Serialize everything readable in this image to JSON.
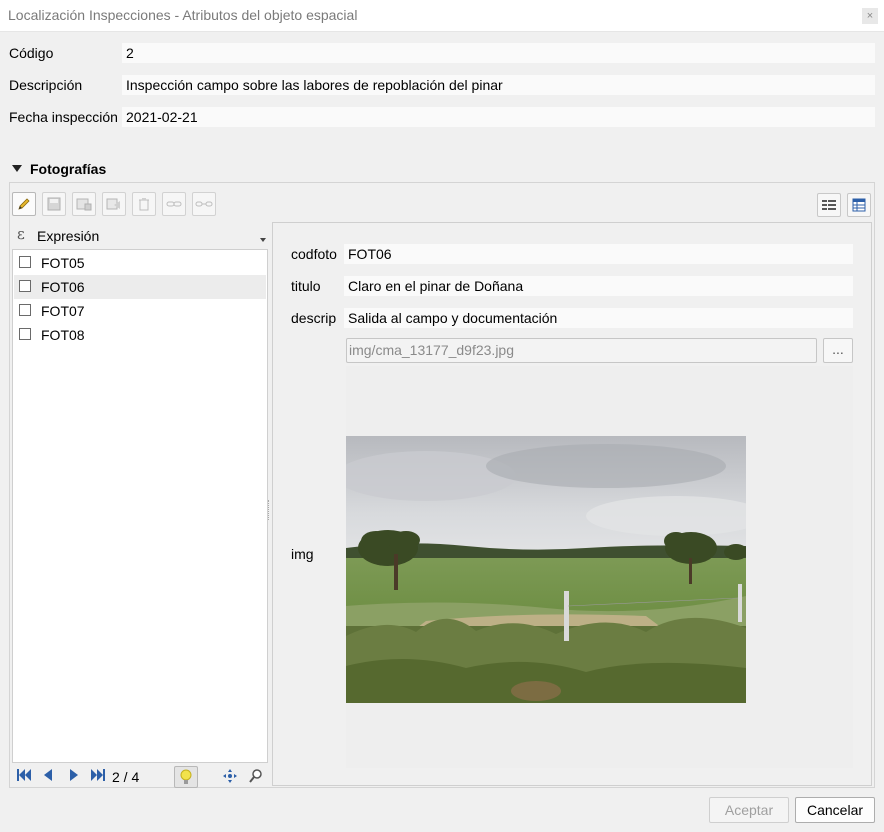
{
  "window": {
    "title": "Localización Inspecciones - Atributos del objeto espacial",
    "close_glyph": "×"
  },
  "form": {
    "fields": [
      {
        "label": "Código",
        "value": "2"
      },
      {
        "label": "Descripción",
        "value": "Inspección campo sobre las labores de repoblación del pinar"
      },
      {
        "label": "Fecha inspección",
        "value": "2021-02-21"
      }
    ]
  },
  "section": {
    "title": "Fotografías"
  },
  "toolbar": {
    "buttons": [
      "pencil-icon",
      "save-icon",
      "add-feature-icon",
      "duplicate-icon",
      "delete-icon",
      "link-icon",
      "unlink-icon"
    ],
    "views": [
      "form-view-icon",
      "table-view-icon"
    ]
  },
  "list": {
    "expression_label": "Expresión",
    "items": [
      {
        "label": "FOT05",
        "selected": false
      },
      {
        "label": "FOT06",
        "selected": true
      },
      {
        "label": "FOT07",
        "selected": false
      },
      {
        "label": "FOT08",
        "selected": false
      }
    ]
  },
  "navigation": {
    "count": "2 / 4"
  },
  "detail": {
    "fields": [
      {
        "label": "codfoto",
        "value": "FOT06"
      },
      {
        "label": "titulo",
        "value": "Claro en el pinar de Doñana"
      },
      {
        "label": "descrip",
        "value": "Salida al campo y documentación"
      }
    ],
    "img_label": "img",
    "img_path": "img/cma_13177_d9f23.jpg",
    "browse_label": "..."
  },
  "footer": {
    "accept_label": "Aceptar",
    "cancel_label": "Cancelar"
  },
  "colors": {
    "accent": "#2c5fa8",
    "selection": "#ececec",
    "field_bg": "#fafafa"
  }
}
